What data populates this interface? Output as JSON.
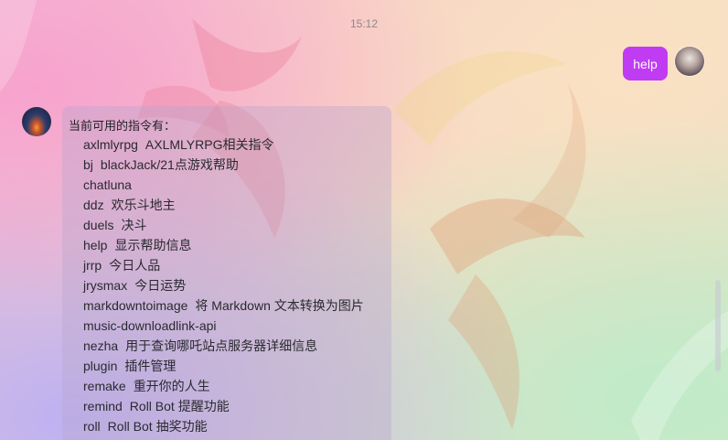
{
  "chat": {
    "timestamp": "15:12",
    "user_message": "help",
    "bot_reply_title": "当前可用的指令有：",
    "commands": [
      {
        "name": "axlmlyrpg",
        "desc": "AXLMLYRPG相关指令"
      },
      {
        "name": "bj",
        "desc": "blackJack/21点游戏帮助"
      },
      {
        "name": "chatluna",
        "desc": ""
      },
      {
        "name": "ddz",
        "desc": "欢乐斗地主"
      },
      {
        "name": "duels",
        "desc": "决斗"
      },
      {
        "name": "help",
        "desc": "显示帮助信息"
      },
      {
        "name": "jrrp",
        "desc": "今日人品"
      },
      {
        "name": "jrysmax",
        "desc": "今日运势"
      },
      {
        "name": "markdowntoimage",
        "desc": "将 Markdown 文本转换为图片"
      },
      {
        "name": "music-downloadlink-api",
        "desc": ""
      },
      {
        "name": "nezha",
        "desc": "用于查询哪吒站点服务器详细信息"
      },
      {
        "name": "plugin",
        "desc": "插件管理"
      },
      {
        "name": "remake",
        "desc": "重开你的人生"
      },
      {
        "name": "remind",
        "desc": "Roll Bot 提醒功能"
      },
      {
        "name": "roll",
        "desc": "Roll Bot 抽奖功能"
      }
    ]
  },
  "colors": {
    "user_bubble": "#c03cf2",
    "timestamp_text": "#8e8a88"
  }
}
